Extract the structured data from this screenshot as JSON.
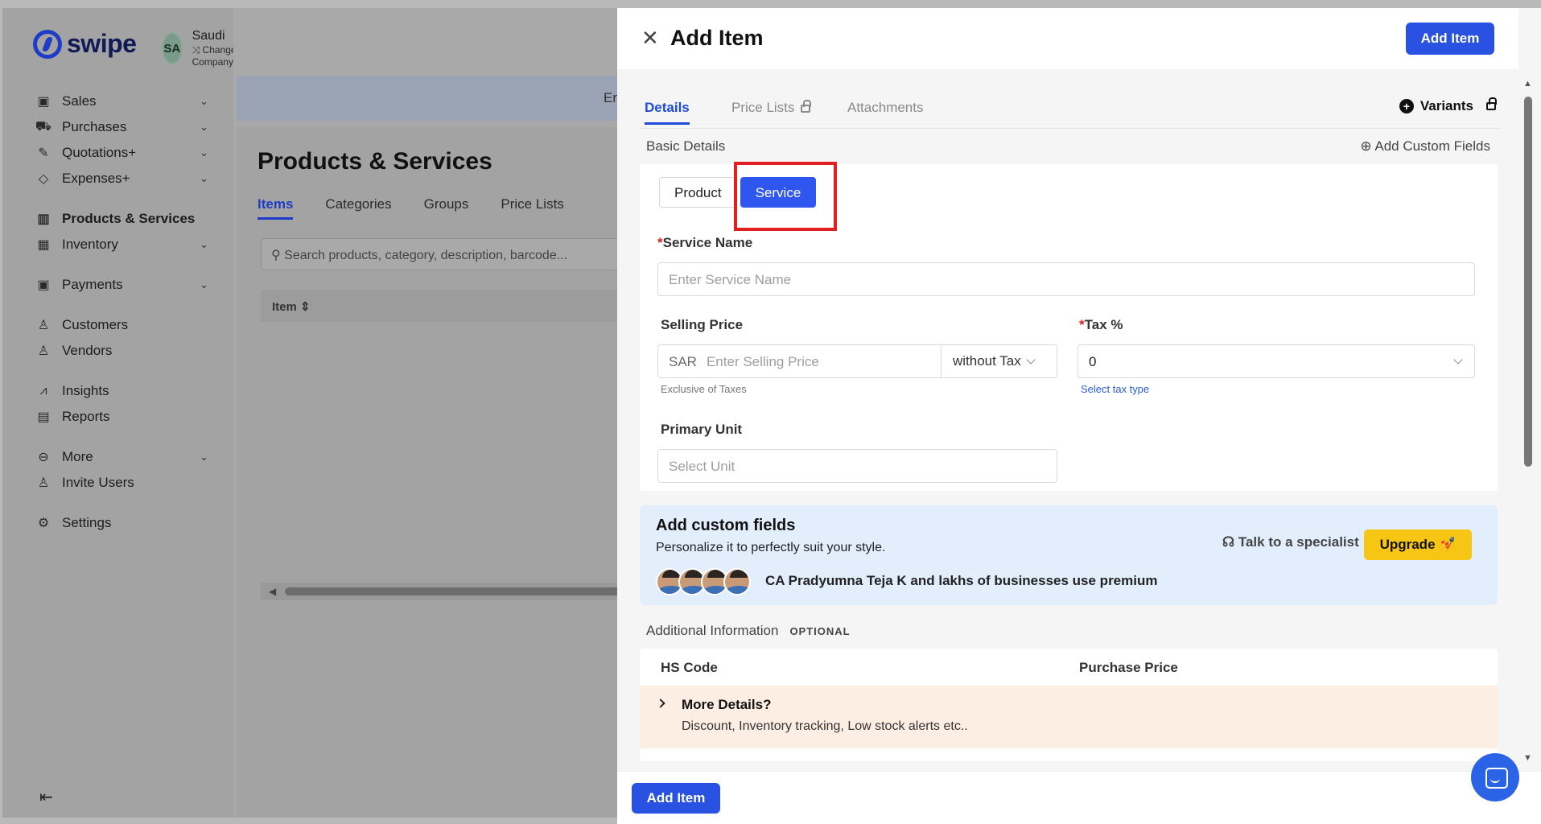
{
  "brand": {
    "name": "swipe"
  },
  "company": {
    "initials": "SA",
    "name": "Saudi",
    "change_label": "Change Company"
  },
  "sidebar": {
    "items": [
      {
        "label": "Sales",
        "icon": "cash-icon",
        "expandable": true
      },
      {
        "label": "Purchases",
        "icon": "cart-icon",
        "expandable": true
      },
      {
        "label": "Quotations+",
        "icon": "pen-icon",
        "expandable": true
      },
      {
        "label": "Expenses+",
        "icon": "tag-icon",
        "expandable": true
      },
      {
        "label": "Products & Services",
        "icon": "barcode-icon",
        "active": true
      },
      {
        "label": "Inventory",
        "icon": "warehouse-icon",
        "expandable": true
      },
      {
        "label": "Payments",
        "icon": "money-icon",
        "expandable": true
      },
      {
        "label": "Customers",
        "icon": "user-icon"
      },
      {
        "label": "Vendors",
        "icon": "users-icon"
      },
      {
        "label": "Insights",
        "icon": "chart-icon"
      },
      {
        "label": "Reports",
        "icon": "report-icon"
      },
      {
        "label": "More",
        "icon": "more-icon",
        "expandable": true
      },
      {
        "label": "Invite Users",
        "icon": "user-plus-icon"
      },
      {
        "label": "Settings",
        "icon": "gear-icon"
      }
    ]
  },
  "main": {
    "banner_text": "Er",
    "title": "Products & Services",
    "tabs": [
      "Items",
      "Categories",
      "Groups",
      "Price Lists"
    ],
    "search_placeholder": "Search products, category, description, barcode...",
    "table_header_item": "Item"
  },
  "drawer": {
    "title": "Add Item",
    "add_button": "Add Item",
    "tabs": [
      "Details",
      "Price Lists",
      "Attachments"
    ],
    "variants_label": "Variants",
    "basic_details_label": "Basic Details",
    "add_custom_fields_label": "Add Custom Fields",
    "type_options": [
      "Product",
      "Service"
    ],
    "selected_type": "Service",
    "service_name_label": "Service Name",
    "service_name_placeholder": "Enter Service Name",
    "selling_price_label": "Selling Price",
    "currency": "SAR",
    "selling_price_placeholder": "Enter Selling Price",
    "tax_mode": "without Tax",
    "exclusive_hint": "Exclusive of Taxes",
    "tax_label": "Tax %",
    "tax_value": "0",
    "tax_hint": "Select tax type",
    "primary_unit_label": "Primary Unit",
    "primary_unit_placeholder": "Select Unit",
    "upsell": {
      "title": "Add custom fields",
      "subtitle": "Personalize it to perfectly suit your style.",
      "specialist_label": "Talk to a specialist",
      "upgrade_label": "Upgrade 💅",
      "social_proof": "CA Pradyumna Teja K and lakhs of businesses use premium"
    },
    "additional_info_label": "Additional Information",
    "optional_label": "OPTIONAL",
    "hs_code_label": "HS Code",
    "purchase_price_label": "Purchase Price",
    "more_details_title": "More Details?",
    "more_details_sub": "Discount, Inventory tracking, Low stock alerts etc.."
  },
  "colors": {
    "primary": "#2952e3",
    "highlight": "#e02020",
    "upgrade": "#f7c614"
  }
}
